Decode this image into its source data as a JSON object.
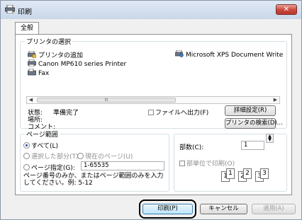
{
  "window": {
    "title": "印刷",
    "close_symbol": "✕"
  },
  "tabs": [
    {
      "label": "全般"
    }
  ],
  "printer_group": {
    "legend": "プリンタの選択",
    "printers": [
      {
        "name": "プリンタの追加",
        "icon": "add-printer-icon"
      },
      {
        "name": "Microsoft XPS Document Write",
        "icon": "xps-printer-icon"
      },
      {
        "name": "Canon MP610 series Printer",
        "icon": "printer-icon"
      },
      {
        "name": "Fax",
        "icon": "fax-icon"
      }
    ],
    "scroll_left": "◀",
    "scroll_right": "▶",
    "scroll_thumb_grip": "III",
    "status_label": "状態:",
    "status_value": "準備完了",
    "location_label": "場所:",
    "comment_label": "コメント:",
    "print_to_file_label": "ファイルへ出力(F)",
    "preferences_button": "詳細設定(R)",
    "find_printer_button": "プリンタの検索(D)..."
  },
  "page_range": {
    "legend": "ページ範囲",
    "all_label": "すべて(L)",
    "selection_label": "選択した部分(T)",
    "current_page_label": "現在のページ(U)",
    "pages_label": "ページ指定(G):",
    "pages_value": "1-65535",
    "hint": "ページ番号のみか、またはページ範囲のみを入力してください。例: 5-12",
    "selected": "all"
  },
  "copies": {
    "label": "部数(C):",
    "value": "1",
    "collate_label": "部単位で印刷(O)",
    "collate_pages": [
      "1",
      "1",
      "2",
      "2",
      "3",
      "3"
    ],
    "spin_up": "▲",
    "spin_down": "▼"
  },
  "footer": {
    "print_button": "印刷(P)",
    "cancel_button": "キャンセル",
    "apply_button": "適用(A)"
  }
}
